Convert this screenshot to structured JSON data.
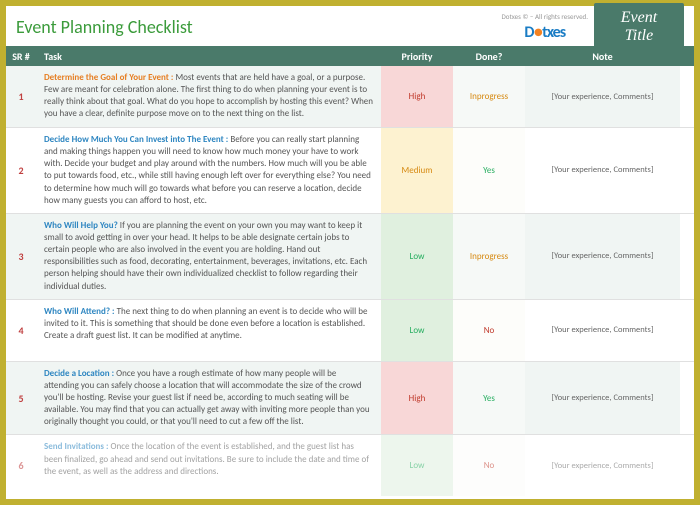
{
  "header": {
    "title": "Event Planning Checklist",
    "logo_copy": "Dotxes © – All rights reserved.",
    "logo_text_part1": "D",
    "logo_text_part2": "txes",
    "logo_sub": "",
    "event_title": "Event Title"
  },
  "columns": {
    "sr": "SR #",
    "task": "Task",
    "priority": "Priority",
    "done": "Done?",
    "note": "Note"
  },
  "rows": [
    {
      "sr": "1",
      "title": "Determine the Goal of Your Event :",
      "title_class": "title-orange",
      "desc": " Most events that are held have a goal, or a purpose. Few are meant for celebration alone. The first thing to do when planning your event is to really think about that goal. What do you hope to accomplish by hosting this event? When you have a clear, definite purpose move on to the next thing on the list.",
      "priority": "High",
      "priority_class": "prio-high",
      "priority_bg": "prio-high-bg",
      "done": "Inprogress",
      "done_class": "done-prog",
      "done_bg": "done-bg-a",
      "note": "[Your experience, Comments]"
    },
    {
      "sr": "2",
      "title": "Decide How Much You Can Invest into The Event :",
      "title_class": "title-blue",
      "desc": " Before you can really start planning and making things happen you will need to know how much money your have to work with. Decide your budget and play around with the numbers. How much will you be able to put towards food, etc., while still having enough left over for everything else? You need to determine how much will go towards what before you can reserve a location, decide how many guests you can afford to host, etc.",
      "priority": "Medium",
      "priority_class": "prio-med",
      "priority_bg": "prio-med-bg",
      "done": "Yes",
      "done_class": "done-yes",
      "done_bg": "done-bg-b",
      "note": "[Your experience, Comments]"
    },
    {
      "sr": "3",
      "title": "Who Will Help You?",
      "title_class": "title-blue",
      "desc": "  If you are planning the event on your own you may want to keep it small to avoid getting in over your head. It helps to be able designate certain jobs to certain people who are also involved in the event you are holding. Hand out responsibilities such as food, decorating, entertainment, beverages, invitations, etc. Each person helping should have their own individualized checklist to follow regarding their individual duties.",
      "priority": "Low",
      "priority_class": "prio-low",
      "priority_bg": "prio-low-bg",
      "done": "Inprogress",
      "done_class": "done-prog",
      "done_bg": "done-bg-a",
      "note": "[Your experience, Comments]"
    },
    {
      "sr": "4",
      "title": "Who Will Attend? :",
      "title_class": "title-blue",
      "desc": " The next thing to do when planning an event is to decide who will be invited to it. This is something that should be done even before a location is established. Create a draft guest list. It can be modified at anytime.",
      "priority": "Low",
      "priority_class": "prio-low",
      "priority_bg": "prio-low-bg",
      "done": "No",
      "done_class": "done-no",
      "done_bg": "done-bg-b",
      "note": "[Your experience, Comments]"
    },
    {
      "sr": "5",
      "title": "Decide a Location :",
      "title_class": "title-blue",
      "desc": "  Once you have a rough estimate of how many people will be attending you can safely choose a location that will accommodate the size of the crowd you'll be hosting. Revise your guest list if need be, according to much seating will be available. You may find that you can actually get away with inviting more people than you originally thought you could, or that you'll need to cut a few off the list.",
      "priority": "High",
      "priority_class": "prio-high",
      "priority_bg": "prio-high-bg",
      "done": "Yes",
      "done_class": "done-yes",
      "done_bg": "done-bg-a",
      "note": "[Your experience, Comments]"
    },
    {
      "sr": "6",
      "title": "Send Invitations :",
      "title_class": "title-blue",
      "desc": " Once the location of the event is established, and the guest list has been finalized, go ahead and send out invitations. Be sure to include the date and time of the event, as well as the address and directions.",
      "priority": "Low",
      "priority_class": "prio-low",
      "priority_bg": "prio-low-bg",
      "done": "No",
      "done_class": "done-no",
      "done_bg": "done-bg-b",
      "note": "[Your experience, Comments]"
    }
  ]
}
